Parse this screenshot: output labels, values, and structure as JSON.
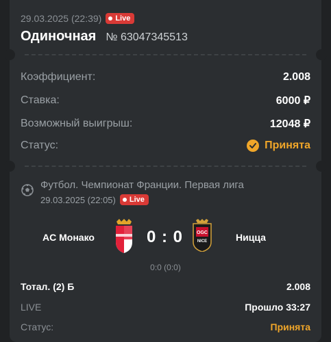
{
  "coupon": {
    "datetime": "29.03.2025 (22:39)",
    "live_label": "Live",
    "title": "Одиночная",
    "bet_number": "№ 63047345513"
  },
  "summary": {
    "coef_label": "Коэффициент:",
    "coef_value": "2.008",
    "stake_label": "Ставка:",
    "stake_value": "6000 ₽",
    "win_label": "Возможный выигрыш:",
    "win_value": "12048 ₽",
    "status_label": "Статус:",
    "status_value": "Принята"
  },
  "event": {
    "league": "Футбол. Чемпионат Франции. Первая лига",
    "datetime": "29.03.2025 (22:05)",
    "live_label": "Live",
    "home_team": "AC Монако",
    "away_team": "Ницца",
    "score": "0 : 0",
    "subscore": "0:0 (0:0)",
    "market_label": "Тотал. (2) Б",
    "market_value": "2.008",
    "live_text": "LIVE",
    "elapsed": "Прошло 33:27",
    "status_label": "Статус:",
    "status_value": "Принята"
  },
  "colors": {
    "background": "#202224",
    "card": "#2b2e31",
    "accent_orange": "#f0a629",
    "live_red": "#d93a36"
  }
}
